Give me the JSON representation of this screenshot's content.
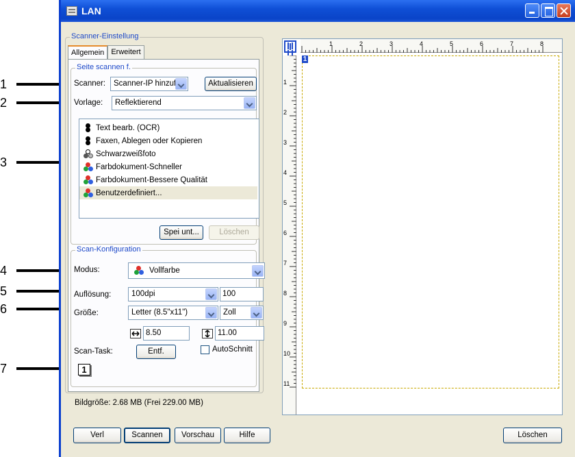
{
  "window": {
    "title": "LAN"
  },
  "callouts": [
    "1",
    "2",
    "3",
    "4",
    "5",
    "6",
    "7"
  ],
  "scanner_settings": {
    "legend": "Scanner-Einstellung",
    "tabs": [
      "Allgemein",
      "Erweitert"
    ],
    "scan_source": {
      "legend": "Seite scannen f.",
      "scanner_label": "Scanner:",
      "scanner_value": "Scanner-IP hinzufüg",
      "refresh_button": "Aktualisieren",
      "template_label": "Vorlage:",
      "template_value": "Reflektierend",
      "profiles": [
        {
          "label": "Text bearb. (OCR)",
          "icon": "bw"
        },
        {
          "label": "Faxen, Ablegen oder Kopieren",
          "icon": "bw"
        },
        {
          "label": "Schwarzweißfoto",
          "icon": "gray"
        },
        {
          "label": "Farbdokument-Schneller",
          "icon": "color"
        },
        {
          "label": "Farbdokument-Bessere Qualität",
          "icon": "color"
        },
        {
          "label": "Benutzerdefiniert...",
          "icon": "color"
        }
      ],
      "save_button": "Spei unt...",
      "delete_button": "Löschen"
    },
    "scan_config": {
      "legend": "Scan-Konfiguration",
      "mode_label": "Modus:",
      "mode_value": "Vollfarbe",
      "resolution_label": "Auflösung:",
      "resolution_value": "100dpi",
      "resolution_number": "100",
      "size_label": "Größe:",
      "size_value": "Letter (8.5\"x11\")",
      "unit_value": "Zoll",
      "width_value": "8.50",
      "height_value": "11.00",
      "scan_task_label": "Scan-Task:",
      "remove_button": "Entf.",
      "autocrop_label": "AutoSchnitt",
      "task_number": "1"
    },
    "image_size": "Bildgröße: 2.68 MB (Frei 229.00 MB)"
  },
  "preview": {
    "ruler_h_labels": [
      "1",
      "2",
      "3",
      "4",
      "5",
      "6",
      "7",
      "8"
    ],
    "ruler_v_labels": [
      "1",
      "2",
      "3",
      "4",
      "5",
      "6",
      "7",
      "8",
      "9",
      "10",
      "11"
    ],
    "page_marker": "1"
  },
  "buttons": {
    "close": "Verl",
    "scan": "Scannen",
    "preview": "Vorschau",
    "help": "Hilfe",
    "clear": "Löschen"
  }
}
